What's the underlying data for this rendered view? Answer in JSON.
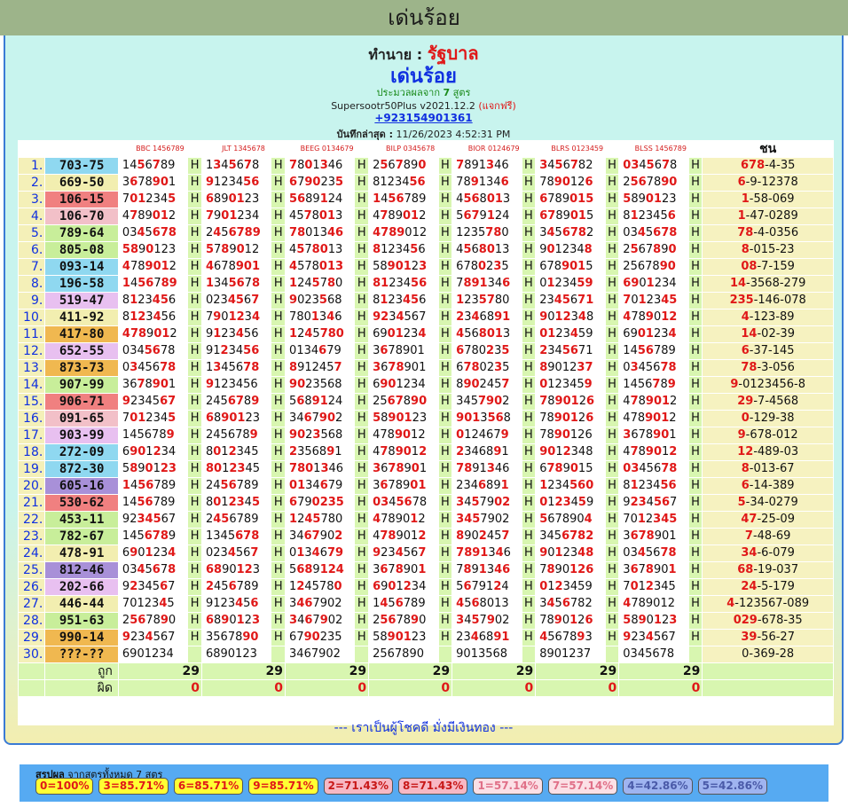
{
  "top_title": "เด่นร้อย",
  "header": {
    "ta_label": "ทำนาย :",
    "lottery": "รัฐบาล",
    "title": "เด่นร้อย",
    "sub_prefix": "ประมวลผลจาก",
    "sub_count": "7",
    "sub_suffix": "สูตร",
    "version": "Supersootr50Plus v2021.12.2",
    "free": "(แจกฟรี)",
    "phone": "+923154901361",
    "date_label": "บันทึกล่าสุด :",
    "date_value": "11/26/2023 4:52:31 PM"
  },
  "columns": [
    "BBC 1456789",
    "JLT 1345678",
    "BEEG 0134679",
    "BILP 0345678",
    "BIOR 0124679",
    "BLRS 0123459",
    "BLSS 1456789"
  ],
  "chon_label": "ชน",
  "rows": [
    {
      "i": "1.",
      "p": "703-75",
      "c": "#8fd8f0",
      "n": [
        "1456789",
        "1345678",
        "7801346",
        "2567890",
        "7891346",
        "3456782",
        "0345678"
      ],
      "ch": "678-4-35"
    },
    {
      "i": "2.",
      "p": "669-50",
      "c": "#f2eeb0",
      "n": [
        "3678901",
        "9123456",
        "6790235",
        "8123456",
        "7891346",
        "7890126",
        "2567890"
      ],
      "ch": "6-9-12378"
    },
    {
      "i": "3.",
      "p": "106-15",
      "c": "#f08080",
      "n": [
        "7012345",
        "6890123",
        "5689124",
        "1456789",
        "4568013",
        "6789015",
        "5890123"
      ],
      "ch": "1-58-069"
    },
    {
      "i": "4.",
      "p": "106-70",
      "c": "#f2c0c8",
      "n": [
        "4789012",
        "7901234",
        "4578013",
        "4789012",
        "5679124",
        "6789015",
        "8123456"
      ],
      "ch": "1-47-0289"
    },
    {
      "i": "5.",
      "p": "789-64",
      "c": "#c8ee9a",
      "n": [
        "0345678",
        "2456789",
        "7801346",
        "4789012",
        "1235780",
        "3456782",
        "0345678"
      ],
      "ch": "78-4-0356"
    },
    {
      "i": "6.",
      "p": "805-08",
      "c": "#c8ee9a",
      "n": [
        "5890123",
        "5789012",
        "4578013",
        "8123456",
        "4568013",
        "9012348",
        "2567890"
      ],
      "ch": "8-015-23"
    },
    {
      "i": "7.",
      "p": "093-14",
      "c": "#8fd8f0",
      "n": [
        "4789012",
        "4678901",
        "4578013",
        "5890123",
        "6780235",
        "6789015",
        "2567890"
      ],
      "ch": "08-7-159"
    },
    {
      "i": "8.",
      "p": "196-58",
      "c": "#8fd8f0",
      "n": [
        "1456789",
        "1345678",
        "1245780",
        "8123456",
        "7891346",
        "0123459",
        "6901234"
      ],
      "ch": "14-3568-279"
    },
    {
      "i": "9.",
      "p": "519-47",
      "c": "#e8c0f0",
      "n": [
        "8123456",
        "0234567",
        "9023568",
        "8123456",
        "1235780",
        "2345671",
        "7012345"
      ],
      "ch": "235-146-078"
    },
    {
      "i": "10.",
      "p": "411-92",
      "c": "#f2eeb0",
      "n": [
        "8123456",
        "7901234",
        "7801346",
        "9234567",
        "2346891",
        "9012348",
        "4789012"
      ],
      "ch": "4-123-89"
    },
    {
      "i": "11.",
      "p": "417-80",
      "c": "#f0b850",
      "n": [
        "4789012",
        "9123456",
        "1245780",
        "6901234",
        "4568013",
        "0123459",
        "6901234"
      ],
      "ch": "14-02-39"
    },
    {
      "i": "12.",
      "p": "652-55",
      "c": "#e8c0f0",
      "n": [
        "0345678",
        "9123456",
        "0134679",
        "3678901",
        "6780235",
        "2345671",
        "1456789"
      ],
      "ch": "6-37-145"
    },
    {
      "i": "13.",
      "p": "873-73",
      "c": "#f0b850",
      "n": [
        "0345678",
        "1345678",
        "8912457",
        "3678901",
        "6780235",
        "8901237",
        "0345678"
      ],
      "ch": "78-3-056"
    },
    {
      "i": "14.",
      "p": "907-99",
      "c": "#c8ee9a",
      "n": [
        "3678901",
        "9123456",
        "9023568",
        "6901234",
        "8902457",
        "0123459",
        "1456789"
      ],
      "ch": "9-0123456-8"
    },
    {
      "i": "15.",
      "p": "906-71",
      "c": "#f08080",
      "n": [
        "9234567",
        "2456789",
        "5689124",
        "2567890",
        "3457902",
        "7890126",
        "4789012"
      ],
      "ch": "29-7-4568"
    },
    {
      "i": "16.",
      "p": "091-65",
      "c": "#f2c0c8",
      "n": [
        "7012345",
        "6890123",
        "3467902",
        "5890123",
        "9013568",
        "7890126",
        "4789012"
      ],
      "ch": "0-129-38"
    },
    {
      "i": "17.",
      "p": "903-99",
      "c": "#e8c0f0",
      "n": [
        "1456789",
        "2456789",
        "9023568",
        "4789012",
        "0124679",
        "7890126",
        "3678901"
      ],
      "ch": "9-678-012"
    },
    {
      "i": "18.",
      "p": "272-09",
      "c": "#8fd8f0",
      "n": [
        "6901234",
        "8012345",
        "2356891",
        "4789012",
        "2346891",
        "9012348",
        "4789012"
      ],
      "ch": "12-489-03"
    },
    {
      "i": "19.",
      "p": "872-30",
      "c": "#8fd8f0",
      "n": [
        "5890123",
        "8012345",
        "7801346",
        "3678901",
        "7891346",
        "6789015",
        "0345678"
      ],
      "ch": "8-013-67"
    },
    {
      "i": "20.",
      "p": "605-16",
      "c": "#a890d8",
      "n": [
        "1456789",
        "2456789",
        "0134679",
        "3678901",
        "2346891",
        "1234560",
        "8123456"
      ],
      "ch": "6-14-389"
    },
    {
      "i": "21.",
      "p": "530-62",
      "c": "#f08080",
      "n": [
        "1456789",
        "8012345",
        "6790235",
        "0345678",
        "3457902",
        "0123459",
        "9234567"
      ],
      "ch": "5-34-0279"
    },
    {
      "i": "22.",
      "p": "453-11",
      "c": "#c8ee9a",
      "n": [
        "9234567",
        "2456789",
        "1245780",
        "4789012",
        "3457902",
        "5678904",
        "7012345"
      ],
      "ch": "47-25-09"
    },
    {
      "i": "23.",
      "p": "782-67",
      "c": "#c8ee9a",
      "n": [
        "1456789",
        "1345678",
        "3467902",
        "4789012",
        "8902457",
        "3456782",
        "3678901"
      ],
      "ch": "7-48-69"
    },
    {
      "i": "24.",
      "p": "478-91",
      "c": "#f2eeb0",
      "n": [
        "6901234",
        "0234567",
        "0134679",
        "9234567",
        "7891346",
        "9012348",
        "0345678"
      ],
      "ch": "34-6-079"
    },
    {
      "i": "25.",
      "p": "812-46",
      "c": "#a890d8",
      "n": [
        "0345678",
        "6890123",
        "5689124",
        "3678901",
        "7891346",
        "7890126",
        "3678901"
      ],
      "ch": "68-19-037"
    },
    {
      "i": "26.",
      "p": "202-66",
      "c": "#e8c0f0",
      "n": [
        "9234567",
        "2456789",
        "1245780",
        "6901234",
        "5679124",
        "0123459",
        "7012345"
      ],
      "ch": "24-5-179"
    },
    {
      "i": "27.",
      "p": "446-44",
      "c": "#f2eeb0",
      "n": [
        "7012345",
        "9123456",
        "3467902",
        "1456789",
        "4568013",
        "3456782",
        "4789012"
      ],
      "ch": "4-123567-089"
    },
    {
      "i": "28.",
      "p": "951-63",
      "c": "#c8ee9a",
      "n": [
        "2567890",
        "6890123",
        "3467902",
        "2567890",
        "3457902",
        "7890126",
        "5890123"
      ],
      "ch": "029-678-35"
    },
    {
      "i": "29.",
      "p": "990-14",
      "c": "#f0b850",
      "n": [
        "9234567",
        "3567890",
        "6790235",
        "5890123",
        "2346891",
        "4567893",
        "9234567"
      ],
      "ch": "39-56-27"
    },
    {
      "i": "30.",
      "p": "???-??",
      "c": "#f0b850",
      "n": [
        "6901234",
        "6890123",
        "3467902",
        "2567890",
        "9013568",
        "8901237",
        "0345678"
      ],
      "ch": "0-369-28"
    }
  ],
  "summary": {
    "correct_label": "ถูก",
    "wrong_label": "ผิด",
    "correct": [
      "29",
      "29",
      "29",
      "29",
      "29",
      "29",
      "29"
    ],
    "wrong": [
      "0",
      "0",
      "0",
      "0",
      "0",
      "0",
      "0"
    ]
  },
  "footer_message": "--- เราเป็นผู้โชคดี มั่งมีเงินทอง ---",
  "bottom": {
    "label_bold": "สรุปผล",
    "label_rest": "จากสูตรทั้งหมด 7 สูตร",
    "badges": [
      {
        "d": "0",
        "pct": "100%",
        "bg": "#ffff33",
        "fg": "#e01818"
      },
      {
        "d": "3",
        "pct": "85.71%",
        "bg": "#ffff33",
        "fg": "#e01818"
      },
      {
        "d": "6",
        "pct": "85.71%",
        "bg": "#ffff33",
        "fg": "#e01818"
      },
      {
        "d": "9",
        "pct": "85.71%",
        "bg": "#ffff33",
        "fg": "#e01818"
      },
      {
        "d": "2",
        "pct": "71.43%",
        "bg": "#f7b8c4",
        "fg": "#c81818"
      },
      {
        "d": "8",
        "pct": "71.43%",
        "bg": "#f7b8c4",
        "fg": "#c81818"
      },
      {
        "d": "1",
        "pct": "57.14%",
        "bg": "#fbe0e6",
        "fg": "#e07088"
      },
      {
        "d": "7",
        "pct": "57.14%",
        "bg": "#fbe0e6",
        "fg": "#e07088"
      },
      {
        "d": "4",
        "pct": "42.86%",
        "bg": "#9fb4f0",
        "fg": "#4a5aa8"
      },
      {
        "d": "5",
        "pct": "42.86%",
        "bg": "#9fb4f0",
        "fg": "#4a5aa8"
      }
    ]
  }
}
